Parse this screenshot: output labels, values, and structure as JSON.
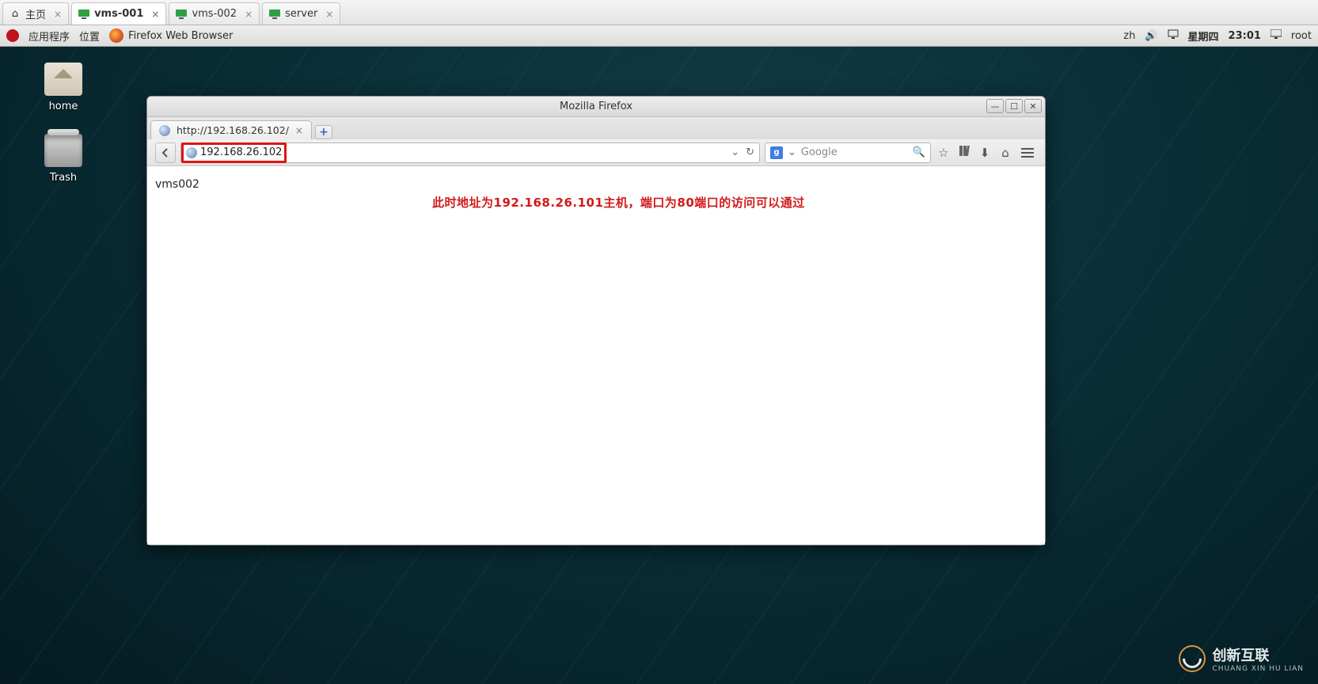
{
  "vm_tabs": [
    {
      "label": "主页",
      "icon": "home-icon",
      "active": false
    },
    {
      "label": "vms-001",
      "icon": "screen-icon",
      "active": true
    },
    {
      "label": "vms-002",
      "icon": "screen-icon",
      "active": false
    },
    {
      "label": "server",
      "icon": "screen-icon",
      "active": false
    }
  ],
  "topbar": {
    "apps_label": "应用程序",
    "places_label": "位置",
    "active_app": "Firefox Web Browser",
    "ime": "zh",
    "date": "星期四",
    "time": "23:01",
    "user": "root"
  },
  "desktop": {
    "home_label": "home",
    "trash_label": "Trash"
  },
  "firefox": {
    "window_title": "Mozilla Firefox",
    "tab_label": "http://192.168.26.102/",
    "url_display": "192.168.26.102",
    "dropdown_glyph": "⌄",
    "reload_glyph": "↻",
    "search_engine_badge": "g",
    "search_placeholder": "Google",
    "toolbar_icons": {
      "back": "back-icon",
      "star": "bookmark-star-icon",
      "sidebar": "bookmarks-sidebar-icon",
      "download": "download-icon",
      "home": "home-icon",
      "menu": "hamburger-menu-icon"
    },
    "page_body": "vms002",
    "annotation": "此时地址为192.168.26.101主机，端口为80端口的访问可以通过"
  },
  "brand": {
    "cn": "创新互联",
    "en": "CHUANG XIN HU LIAN"
  }
}
